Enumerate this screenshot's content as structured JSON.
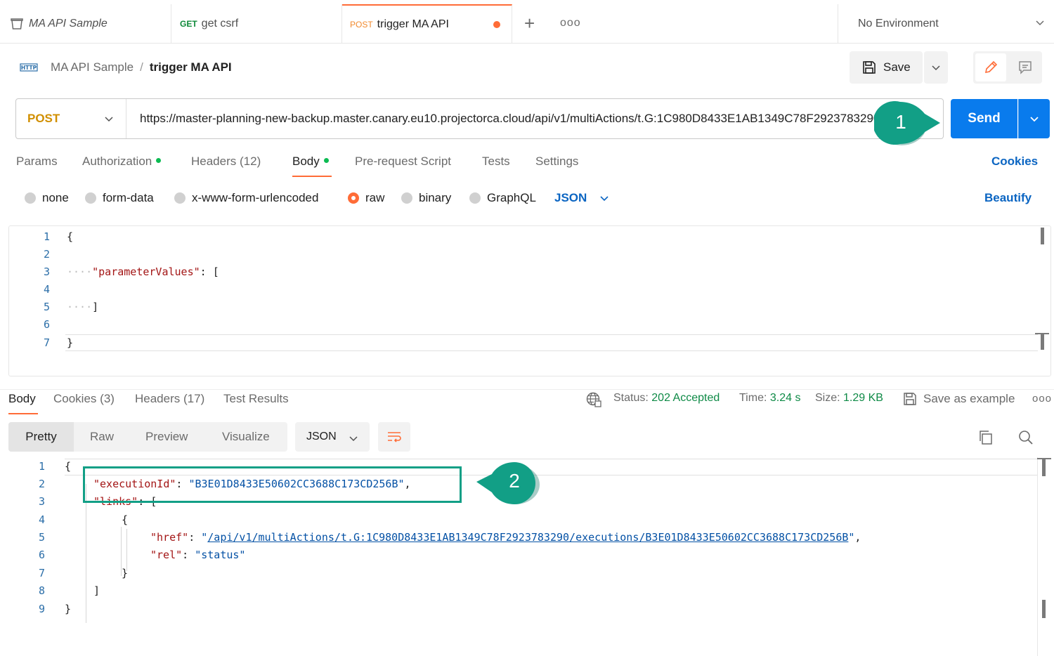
{
  "tabs": [
    {
      "method": "",
      "label": "MA API Sample"
    },
    {
      "method": "GET",
      "label": "get csrf"
    },
    {
      "method": "POST",
      "label": "trigger MA API"
    }
  ],
  "tab_actions": {
    "new_tab": "+",
    "more": "ooo"
  },
  "environment": {
    "label": "No Environment"
  },
  "breadcrumb": {
    "icon_text": "HTTP",
    "collection": "MA API Sample",
    "separator": "/",
    "request": "trigger MA API"
  },
  "toolbar": {
    "save_label": "Save"
  },
  "request": {
    "method": "POST",
    "url": "https://master-planning-new-backup.master.canary.eu10.projectorca.cloud/api/v1/multiActions/t.G:1C980D8433E1AB1349C78F2923783290/executions",
    "send_label": "Send"
  },
  "callouts": [
    {
      "number": "1"
    },
    {
      "number": "2"
    }
  ],
  "request_tabs": {
    "params": "Params",
    "authorization": "Authorization",
    "headers": "Headers",
    "headers_count": "(12)",
    "body": "Body",
    "pre_request": "Pre-request Script",
    "tests": "Tests",
    "settings": "Settings",
    "cookies": "Cookies"
  },
  "body_types": {
    "none": "none",
    "form_data": "form-data",
    "urlencoded": "x-www-form-urlencoded",
    "raw": "raw",
    "binary": "binary",
    "graphql": "GraphQL",
    "format": "JSON",
    "beautify": "Beautify"
  },
  "request_body_lines": [
    {
      "n": "1",
      "text": "{"
    },
    {
      "n": "2",
      "text": ""
    },
    {
      "n": "3",
      "key": "\"parameterValues\"",
      "rest": ": ["
    },
    {
      "n": "4",
      "text": ""
    },
    {
      "n": "5",
      "text": "]"
    },
    {
      "n": "6",
      "text": ""
    },
    {
      "n": "7",
      "text": "}"
    }
  ],
  "response_tabs": {
    "body": "Body",
    "cookies": "Cookies",
    "cookies_count": "(3)",
    "headers": "Headers",
    "headers_count": "(17)",
    "test_results": "Test Results"
  },
  "response_meta": {
    "status_label": "Status:",
    "status_value": "202 Accepted",
    "time_label": "Time:",
    "time_value": "3.24 s",
    "size_label": "Size:",
    "size_value": "1.29 KB",
    "save_example": "Save as example",
    "more": "ooo"
  },
  "response_view": {
    "pretty": "Pretty",
    "raw": "Raw",
    "preview": "Preview",
    "visualize": "Visualize",
    "format": "JSON"
  },
  "response_body": {
    "line_numbers": [
      "1",
      "2",
      "3",
      "4",
      "5",
      "6",
      "7",
      "8",
      "9"
    ],
    "open_brace": "{",
    "close_brace": "}",
    "execution_id_key": "\"executionId\"",
    "execution_id_value": "\"B3E01D8433E50602CC3688C173CD256B\"",
    "links_key": "\"links\"",
    "links_open": "[",
    "links_close": "]",
    "item_open": "{",
    "item_close": "}",
    "href_key": "\"href\"",
    "href_value": "/api/v1/multiActions/t.G:1C980D8433E1AB1349C78F2923783290/executions/B3E01D8433E50602CC3688C173CD256B",
    "rel_key": "\"rel\"",
    "rel_value": "\"status\""
  },
  "colors": {
    "accent": "#ff6c37",
    "send": "#097bed",
    "link": "#0b65c2",
    "callout": "#129f86",
    "status_ok": "#0e8a46"
  }
}
